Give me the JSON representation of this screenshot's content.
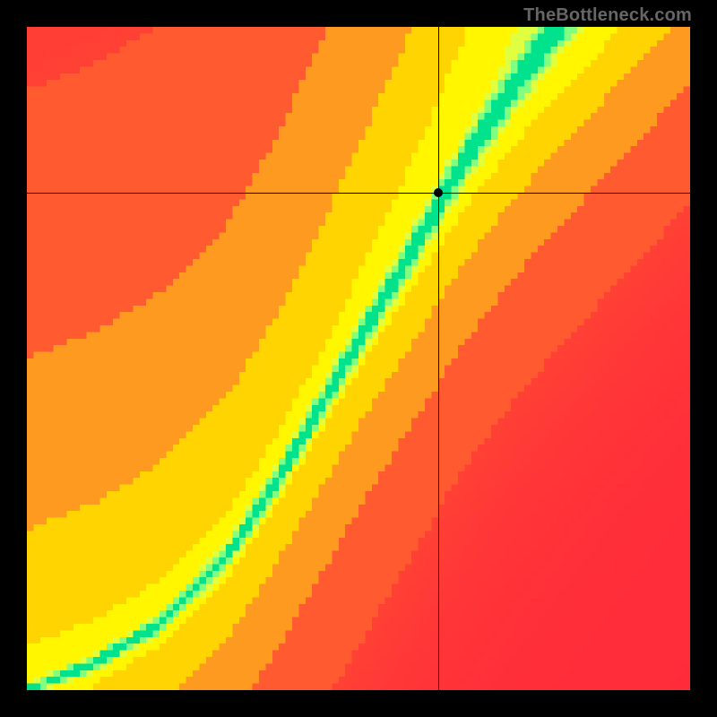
{
  "watermark": "TheBottleneck.com",
  "chart_data": {
    "type": "heatmap",
    "title": "",
    "xlabel": "",
    "ylabel": "",
    "xlim": [
      0,
      1
    ],
    "ylim": [
      0,
      1
    ],
    "grid_resolution": 100,
    "colormap": {
      "stops": [
        {
          "t": 0.0,
          "color": "#ff2a3a"
        },
        {
          "t": 0.2,
          "color": "#ff5a30"
        },
        {
          "t": 0.4,
          "color": "#ff9a20"
        },
        {
          "t": 0.55,
          "color": "#ffd400"
        },
        {
          "t": 0.68,
          "color": "#fff600"
        },
        {
          "t": 0.8,
          "color": "#dfff40"
        },
        {
          "t": 0.9,
          "color": "#80ff80"
        },
        {
          "t": 1.0,
          "color": "#00e28c"
        }
      ]
    },
    "ridge": {
      "description": "Optimal-match curve; score falls off with distance from this curve, modulated by x.",
      "control_points": [
        {
          "x": 0.0,
          "y": 0.0
        },
        {
          "x": 0.1,
          "y": 0.04
        },
        {
          "x": 0.2,
          "y": 0.1
        },
        {
          "x": 0.3,
          "y": 0.2
        },
        {
          "x": 0.38,
          "y": 0.32
        },
        {
          "x": 0.45,
          "y": 0.44
        },
        {
          "x": 0.52,
          "y": 0.56
        },
        {
          "x": 0.58,
          "y": 0.66
        },
        {
          "x": 0.66,
          "y": 0.8
        },
        {
          "x": 0.74,
          "y": 0.92
        },
        {
          "x": 0.8,
          "y": 1.0
        }
      ],
      "width_profile": [
        {
          "x": 0.0,
          "w": 0.012
        },
        {
          "x": 0.2,
          "w": 0.02
        },
        {
          "x": 0.4,
          "w": 0.032
        },
        {
          "x": 0.6,
          "w": 0.045
        },
        {
          "x": 0.8,
          "w": 0.06
        },
        {
          "x": 1.0,
          "w": 0.075
        }
      ]
    },
    "background_falloff": {
      "above_curve_softness": 0.55,
      "below_curve_softness": 0.28
    },
    "crosshair": {
      "x": 0.62,
      "y": 0.75
    },
    "marker": {
      "x": 0.62,
      "y": 0.75
    }
  }
}
